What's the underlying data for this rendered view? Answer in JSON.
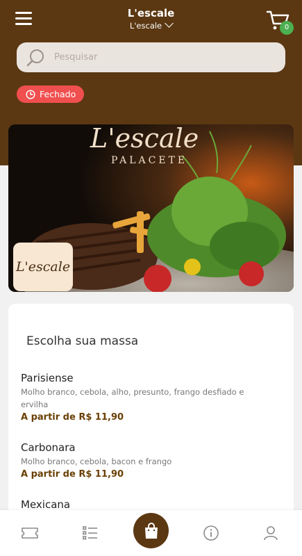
{
  "header": {
    "store_name": "L'escale",
    "store_selector": "L'escale",
    "cart_count": "0"
  },
  "search": {
    "placeholder": "Pesquisar"
  },
  "status": {
    "label": "Fechado"
  },
  "banner": {
    "logo_text": "L'escale"
  },
  "menu": {
    "section_title": "Escolha sua massa",
    "items": [
      {
        "name": "Parisiense",
        "description": "Molho branco, cebola, alho, presunto, frango desfiado e ervilha",
        "price": "A partir de R$ 11,90"
      },
      {
        "name": "Carbonara",
        "description": "Molho branco, cebola, bacon e frango",
        "price": "A partir de R$ 11,90"
      },
      {
        "name": "Mexicana"
      }
    ]
  },
  "bottom_nav": {
    "items": [
      {
        "icon": "ticket-icon"
      },
      {
        "icon": "list-icon"
      },
      {
        "icon": "shopping-bag-icon"
      },
      {
        "icon": "info-icon"
      },
      {
        "icon": "user-icon"
      }
    ]
  },
  "colors": {
    "brand": "#5b3812",
    "closed": "#f04f4f",
    "badge": "#4caf50",
    "price": "#6a4005"
  }
}
